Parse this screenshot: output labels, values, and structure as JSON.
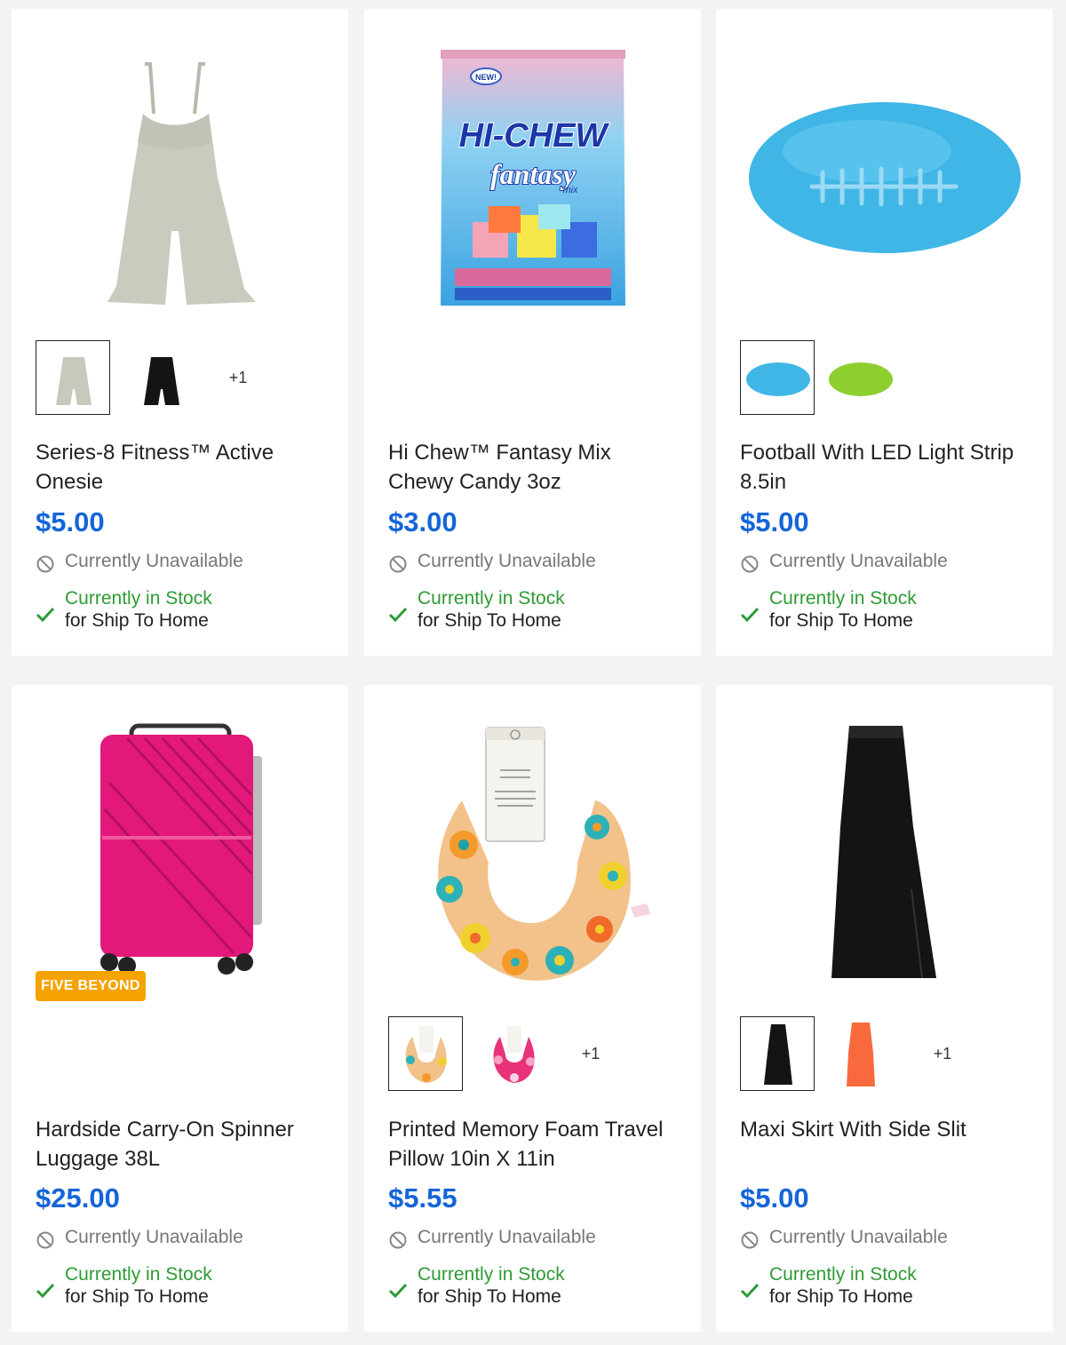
{
  "colors": {
    "price": "#1565d8",
    "in_stock": "#2e9b34",
    "unavailable": "#777777",
    "badge_bg": "#f5a300",
    "page_bg": "#f3f3f4"
  },
  "products": [
    {
      "title": "Series-8 Fitness™ Active Onesie",
      "price": "$5.00",
      "availability": "Currently Unavailable",
      "stock_line1": "Currently in Stock",
      "stock_line2": "for Ship To Home",
      "swatch_more": "+1",
      "image_icon": "romper-icon"
    },
    {
      "title": "Hi Chew™ Fantasy Mix Chewy Candy 3oz",
      "price": "$3.00",
      "availability": "Currently Unavailable",
      "stock_line1": "Currently in Stock",
      "stock_line2": "for Ship To Home",
      "image_text": {
        "brand": "HI-CHEW",
        "line": "fantasy",
        "mix": "mix",
        "new": "NEW!"
      },
      "image_icon": "candy-bag-icon"
    },
    {
      "title": "Football With LED Light Strip 8.5in",
      "price": "$5.00",
      "availability": "Currently Unavailable",
      "stock_line1": "Currently in Stock",
      "stock_line2": "for Ship To Home",
      "image_icon": "football-icon"
    },
    {
      "title": "Hardside Carry-On Spinner Luggage 38L",
      "price": "$25.00",
      "availability": "Currently Unavailable",
      "stock_line1": "Currently in Stock",
      "stock_line2": "for Ship To Home",
      "badge": "FIVE BEYOND",
      "image_icon": "suitcase-icon"
    },
    {
      "title": "Printed Memory Foam Travel Pillow 10in X 11in",
      "price": "$5.55",
      "availability": "Currently Unavailable",
      "stock_line1": "Currently in Stock",
      "stock_line2": "for Ship To Home",
      "swatch_more": "+1",
      "image_icon": "neck-pillow-icon"
    },
    {
      "title": "Maxi Skirt With Side Slit",
      "price": "$5.00",
      "availability": "Currently Unavailable",
      "stock_line1": "Currently in Stock",
      "stock_line2": "for Ship To Home",
      "swatch_more": "+1",
      "image_icon": "skirt-icon"
    }
  ]
}
